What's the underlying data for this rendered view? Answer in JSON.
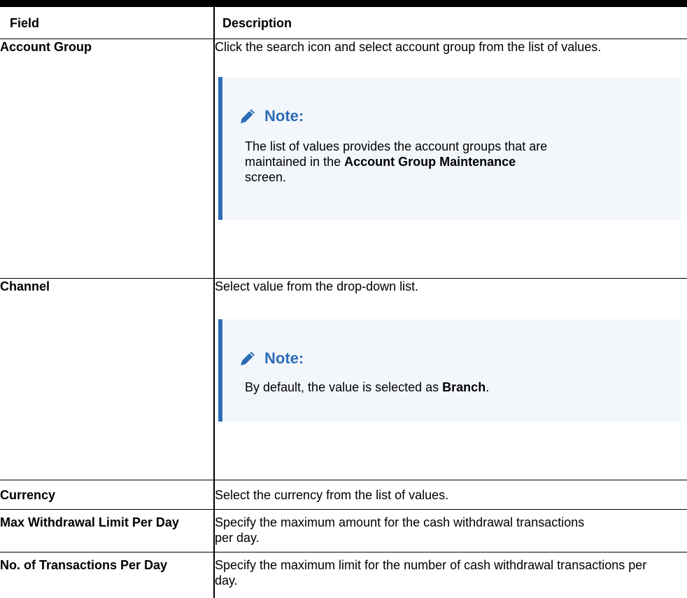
{
  "table": {
    "headers": {
      "field": "Field",
      "description": "Description"
    },
    "rows": [
      {
        "field": "Account Group",
        "description": "Click the search icon and select account group from the list of values.",
        "note": {
          "title": "Note:",
          "text_1": "The list of values provides the account groups that are maintained in the ",
          "bold": "Account Group Maintenance",
          "text_2": " screen."
        }
      },
      {
        "field": "Channel",
        "description": "Select value from the drop-down list.",
        "note": {
          "title": "Note:",
          "text_1": "By default, the value is selected as ",
          "bold": "Branch",
          "text_2": "."
        }
      },
      {
        "field": "Currency",
        "description": "Select the currency from the list of values."
      },
      {
        "field": "Max Withdrawal Limit Per Day",
        "description": "Specify the maximum amount for the cash withdrawal transactions per day."
      },
      {
        "field": "No. of Transactions Per Day",
        "description": "Specify the maximum limit for the number of cash withdrawal transactions per day."
      }
    ]
  },
  "colors": {
    "note_accent": "#2d6db6",
    "note_background": "#f3f7fc"
  },
  "icons": {
    "note": "pencil-icon"
  }
}
